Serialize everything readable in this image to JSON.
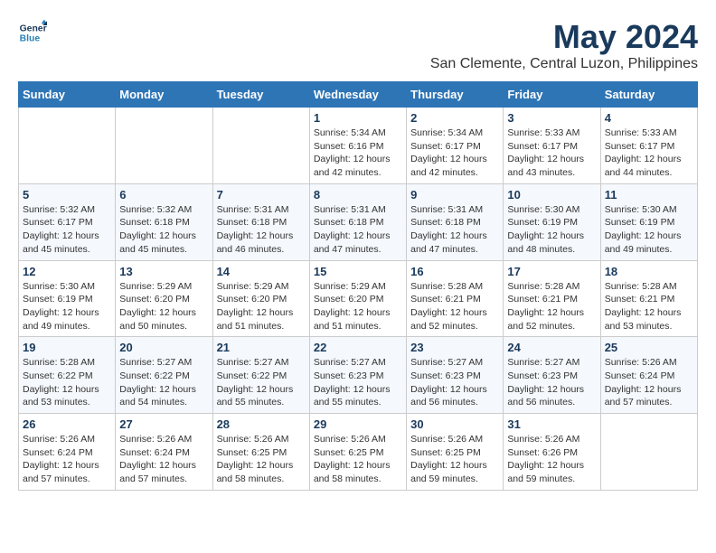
{
  "logo": {
    "line1": "General",
    "line2": "Blue"
  },
  "title": "May 2024",
  "subtitle": "San Clemente, Central Luzon, Philippines",
  "days_header": [
    "Sunday",
    "Monday",
    "Tuesday",
    "Wednesday",
    "Thursday",
    "Friday",
    "Saturday"
  ],
  "weeks": [
    [
      {
        "day": "",
        "info": ""
      },
      {
        "day": "",
        "info": ""
      },
      {
        "day": "",
        "info": ""
      },
      {
        "day": "1",
        "info": "Sunrise: 5:34 AM\nSunset: 6:16 PM\nDaylight: 12 hours\nand 42 minutes."
      },
      {
        "day": "2",
        "info": "Sunrise: 5:34 AM\nSunset: 6:17 PM\nDaylight: 12 hours\nand 42 minutes."
      },
      {
        "day": "3",
        "info": "Sunrise: 5:33 AM\nSunset: 6:17 PM\nDaylight: 12 hours\nand 43 minutes."
      },
      {
        "day": "4",
        "info": "Sunrise: 5:33 AM\nSunset: 6:17 PM\nDaylight: 12 hours\nand 44 minutes."
      }
    ],
    [
      {
        "day": "5",
        "info": "Sunrise: 5:32 AM\nSunset: 6:17 PM\nDaylight: 12 hours\nand 45 minutes."
      },
      {
        "day": "6",
        "info": "Sunrise: 5:32 AM\nSunset: 6:18 PM\nDaylight: 12 hours\nand 45 minutes."
      },
      {
        "day": "7",
        "info": "Sunrise: 5:31 AM\nSunset: 6:18 PM\nDaylight: 12 hours\nand 46 minutes."
      },
      {
        "day": "8",
        "info": "Sunrise: 5:31 AM\nSunset: 6:18 PM\nDaylight: 12 hours\nand 47 minutes."
      },
      {
        "day": "9",
        "info": "Sunrise: 5:31 AM\nSunset: 6:18 PM\nDaylight: 12 hours\nand 47 minutes."
      },
      {
        "day": "10",
        "info": "Sunrise: 5:30 AM\nSunset: 6:19 PM\nDaylight: 12 hours\nand 48 minutes."
      },
      {
        "day": "11",
        "info": "Sunrise: 5:30 AM\nSunset: 6:19 PM\nDaylight: 12 hours\nand 49 minutes."
      }
    ],
    [
      {
        "day": "12",
        "info": "Sunrise: 5:30 AM\nSunset: 6:19 PM\nDaylight: 12 hours\nand 49 minutes."
      },
      {
        "day": "13",
        "info": "Sunrise: 5:29 AM\nSunset: 6:20 PM\nDaylight: 12 hours\nand 50 minutes."
      },
      {
        "day": "14",
        "info": "Sunrise: 5:29 AM\nSunset: 6:20 PM\nDaylight: 12 hours\nand 51 minutes."
      },
      {
        "day": "15",
        "info": "Sunrise: 5:29 AM\nSunset: 6:20 PM\nDaylight: 12 hours\nand 51 minutes."
      },
      {
        "day": "16",
        "info": "Sunrise: 5:28 AM\nSunset: 6:21 PM\nDaylight: 12 hours\nand 52 minutes."
      },
      {
        "day": "17",
        "info": "Sunrise: 5:28 AM\nSunset: 6:21 PM\nDaylight: 12 hours\nand 52 minutes."
      },
      {
        "day": "18",
        "info": "Sunrise: 5:28 AM\nSunset: 6:21 PM\nDaylight: 12 hours\nand 53 minutes."
      }
    ],
    [
      {
        "day": "19",
        "info": "Sunrise: 5:28 AM\nSunset: 6:22 PM\nDaylight: 12 hours\nand 53 minutes."
      },
      {
        "day": "20",
        "info": "Sunrise: 5:27 AM\nSunset: 6:22 PM\nDaylight: 12 hours\nand 54 minutes."
      },
      {
        "day": "21",
        "info": "Sunrise: 5:27 AM\nSunset: 6:22 PM\nDaylight: 12 hours\nand 55 minutes."
      },
      {
        "day": "22",
        "info": "Sunrise: 5:27 AM\nSunset: 6:23 PM\nDaylight: 12 hours\nand 55 minutes."
      },
      {
        "day": "23",
        "info": "Sunrise: 5:27 AM\nSunset: 6:23 PM\nDaylight: 12 hours\nand 56 minutes."
      },
      {
        "day": "24",
        "info": "Sunrise: 5:27 AM\nSunset: 6:23 PM\nDaylight: 12 hours\nand 56 minutes."
      },
      {
        "day": "25",
        "info": "Sunrise: 5:26 AM\nSunset: 6:24 PM\nDaylight: 12 hours\nand 57 minutes."
      }
    ],
    [
      {
        "day": "26",
        "info": "Sunrise: 5:26 AM\nSunset: 6:24 PM\nDaylight: 12 hours\nand 57 minutes."
      },
      {
        "day": "27",
        "info": "Sunrise: 5:26 AM\nSunset: 6:24 PM\nDaylight: 12 hours\nand 57 minutes."
      },
      {
        "day": "28",
        "info": "Sunrise: 5:26 AM\nSunset: 6:25 PM\nDaylight: 12 hours\nand 58 minutes."
      },
      {
        "day": "29",
        "info": "Sunrise: 5:26 AM\nSunset: 6:25 PM\nDaylight: 12 hours\nand 58 minutes."
      },
      {
        "day": "30",
        "info": "Sunrise: 5:26 AM\nSunset: 6:25 PM\nDaylight: 12 hours\nand 59 minutes."
      },
      {
        "day": "31",
        "info": "Sunrise: 5:26 AM\nSunset: 6:26 PM\nDaylight: 12 hours\nand 59 minutes."
      },
      {
        "day": "",
        "info": ""
      }
    ]
  ]
}
